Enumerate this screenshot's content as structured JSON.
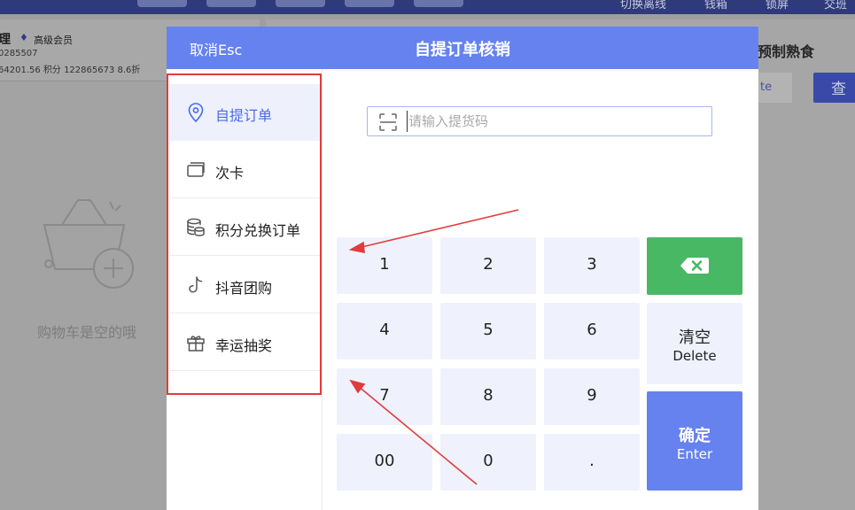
{
  "background": {
    "top_bar_items": [
      "切换离线",
      "钱箱",
      "锁屏",
      "交班"
    ],
    "member": {
      "name": "理",
      "level": "高级会员",
      "id": "0285507",
      "stats": "64201.56   积分 122865673   8.6折"
    },
    "cart_empty_text": "购物车是空的哦",
    "right_title": "预制熟食",
    "right_tag": "te",
    "right_button": "查"
  },
  "modal": {
    "title": "自提订单核销",
    "cancel_label": "取消Esc",
    "menu": [
      {
        "label": "自提订单",
        "icon": "location-pin-icon",
        "active": true
      },
      {
        "label": "次卡",
        "icon": "card-icon",
        "active": false
      },
      {
        "label": "积分兑换订单",
        "icon": "coins-icon",
        "active": false
      },
      {
        "label": "抖音团购",
        "icon": "tiktok-icon",
        "active": false
      },
      {
        "label": "幸运抽奖",
        "icon": "gift-icon",
        "active": false
      }
    ],
    "input": {
      "placeholder": "请输入提货码",
      "value": ""
    },
    "keypad": {
      "digits": [
        "1",
        "2",
        "3",
        "4",
        "5",
        "6",
        "7",
        "8",
        "9",
        "00",
        "0",
        "."
      ],
      "clear_label": "清空",
      "clear_sub": "Delete",
      "enter_label": "确定",
      "enter_sub": "Enter"
    }
  },
  "colors": {
    "header": "#6682ee",
    "backspace": "#48b865",
    "annotation": "#e23b3b"
  }
}
